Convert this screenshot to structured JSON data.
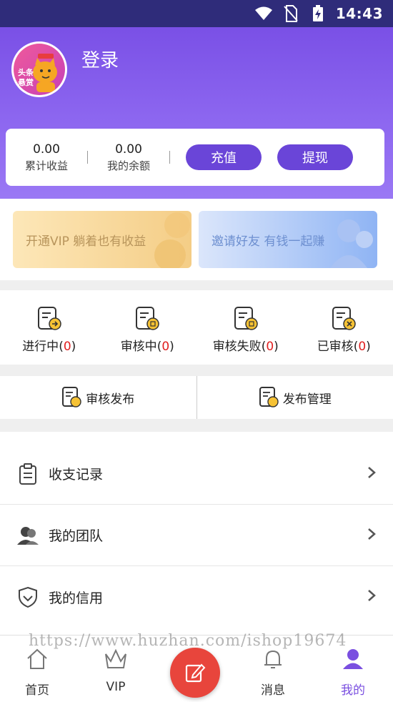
{
  "status_bar": {
    "time": "14:43"
  },
  "profile": {
    "login_label": "登录",
    "avatar_text_line1": "头条",
    "avatar_text_line2": "悬赏"
  },
  "balance": {
    "total_income_value": "0.00",
    "total_income_label": "累计收益",
    "balance_value": "0.00",
    "balance_label": "我的余额",
    "recharge_label": "充值",
    "withdraw_label": "提现"
  },
  "promo": {
    "vip_text": "开通VIP 躺着也有收益",
    "invite_text": "邀请好友 有钱一起赚"
  },
  "task_status": [
    {
      "label": "进行中",
      "count": "0"
    },
    {
      "label": "审核中",
      "count": "0"
    },
    {
      "label": "审核失败",
      "count": "0"
    },
    {
      "label": "已审核",
      "count": "0"
    }
  ],
  "audit": {
    "publish_review": "审核发布",
    "publish_manage": "发布管理"
  },
  "menu": [
    {
      "label": "收支记录",
      "icon": "clipboard-icon"
    },
    {
      "label": "我的团队",
      "icon": "team-icon"
    },
    {
      "label": "我的信用",
      "icon": "shield-icon"
    }
  ],
  "watermark": "https://www.huzhan.com/ishop19674",
  "bottom_nav": [
    {
      "label": "首页",
      "icon": "home-icon"
    },
    {
      "label": "VIP",
      "icon": "crown-icon"
    },
    {
      "label": "消息",
      "icon": "bell-icon"
    },
    {
      "label": "我的",
      "icon": "user-icon",
      "active": true
    }
  ],
  "colors": {
    "accent": "#7a4fe0",
    "fab": "#e8453c",
    "count": "#e02020"
  }
}
